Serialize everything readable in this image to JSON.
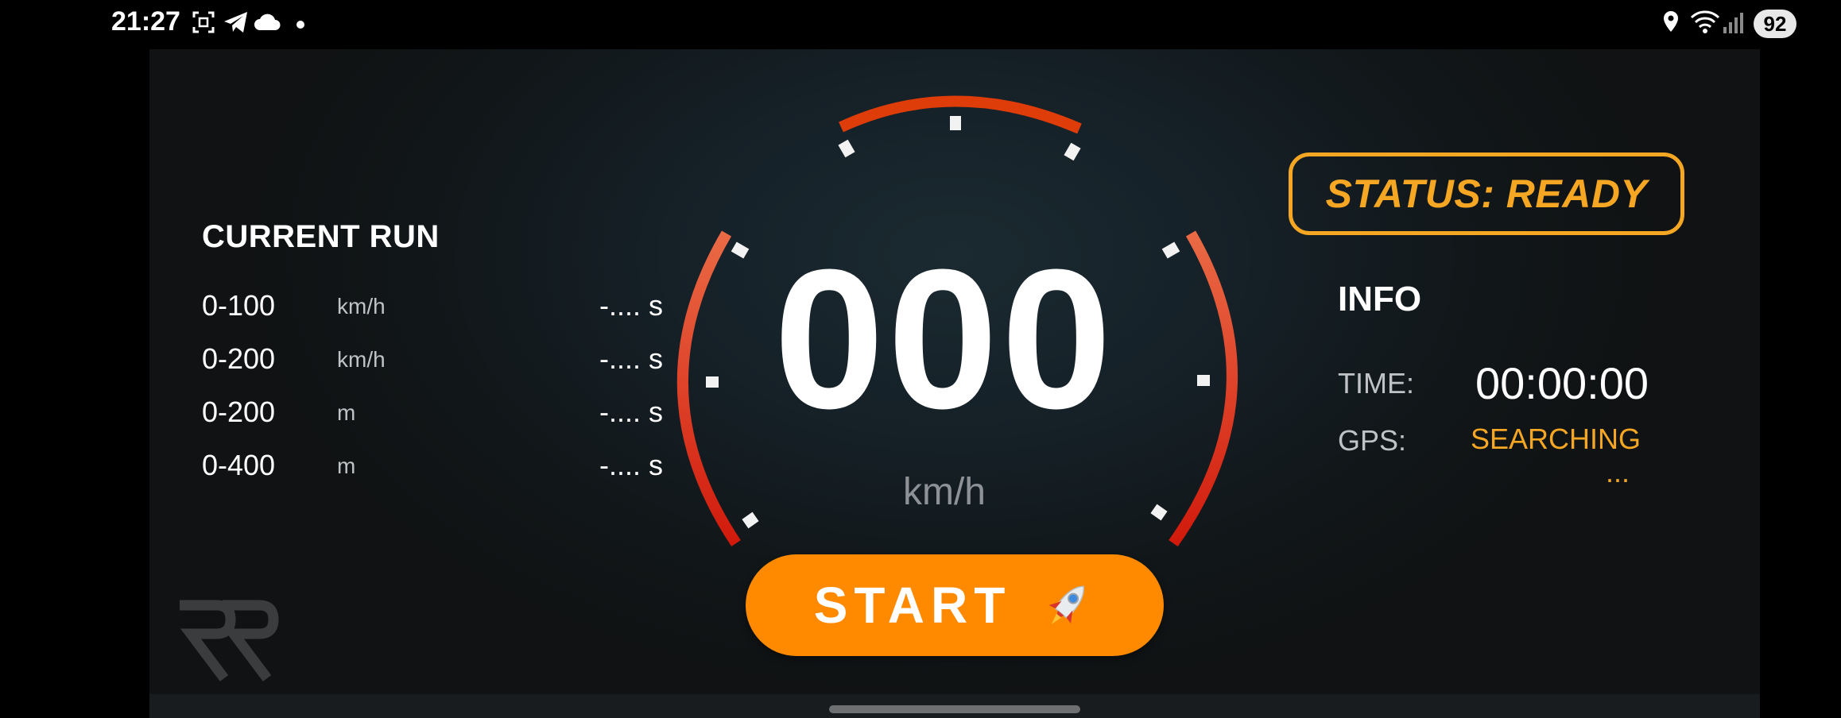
{
  "status_bar": {
    "time": "21:27",
    "battery": "92",
    "icons": [
      "screenshot-icon",
      "telegram-icon",
      "cloud-icon",
      "dot-icon",
      "location-icon",
      "wifi-icon",
      "signal-icon"
    ]
  },
  "current_run": {
    "title": "CURRENT RUN",
    "rows": [
      {
        "distance": "0-100",
        "unit": "km/h",
        "value": "-.... s"
      },
      {
        "distance": "0-200",
        "unit": "km/h",
        "value": "-.... s"
      },
      {
        "distance": "0-200",
        "unit": "m",
        "value": "-.... s"
      },
      {
        "distance": "0-400",
        "unit": "m",
        "value": "-.... s"
      }
    ]
  },
  "gauge": {
    "speed": "000",
    "unit": "km/h",
    "arc_color_top": "#e03a0a",
    "arc_color_side": "#e8472a"
  },
  "start_button": {
    "label": "START",
    "icon": "rocket-icon"
  },
  "status": {
    "text": "STATUS: READY",
    "color": "#f5a623"
  },
  "info": {
    "title": "INFO",
    "time_label": "TIME:",
    "time_value": "00:00:00",
    "gps_label": "GPS:",
    "gps_value": "SEARCHING",
    "gps_dots": "..."
  },
  "colors": {
    "accent": "#ff8a00",
    "status": "#f5a623",
    "background": "#111618"
  }
}
